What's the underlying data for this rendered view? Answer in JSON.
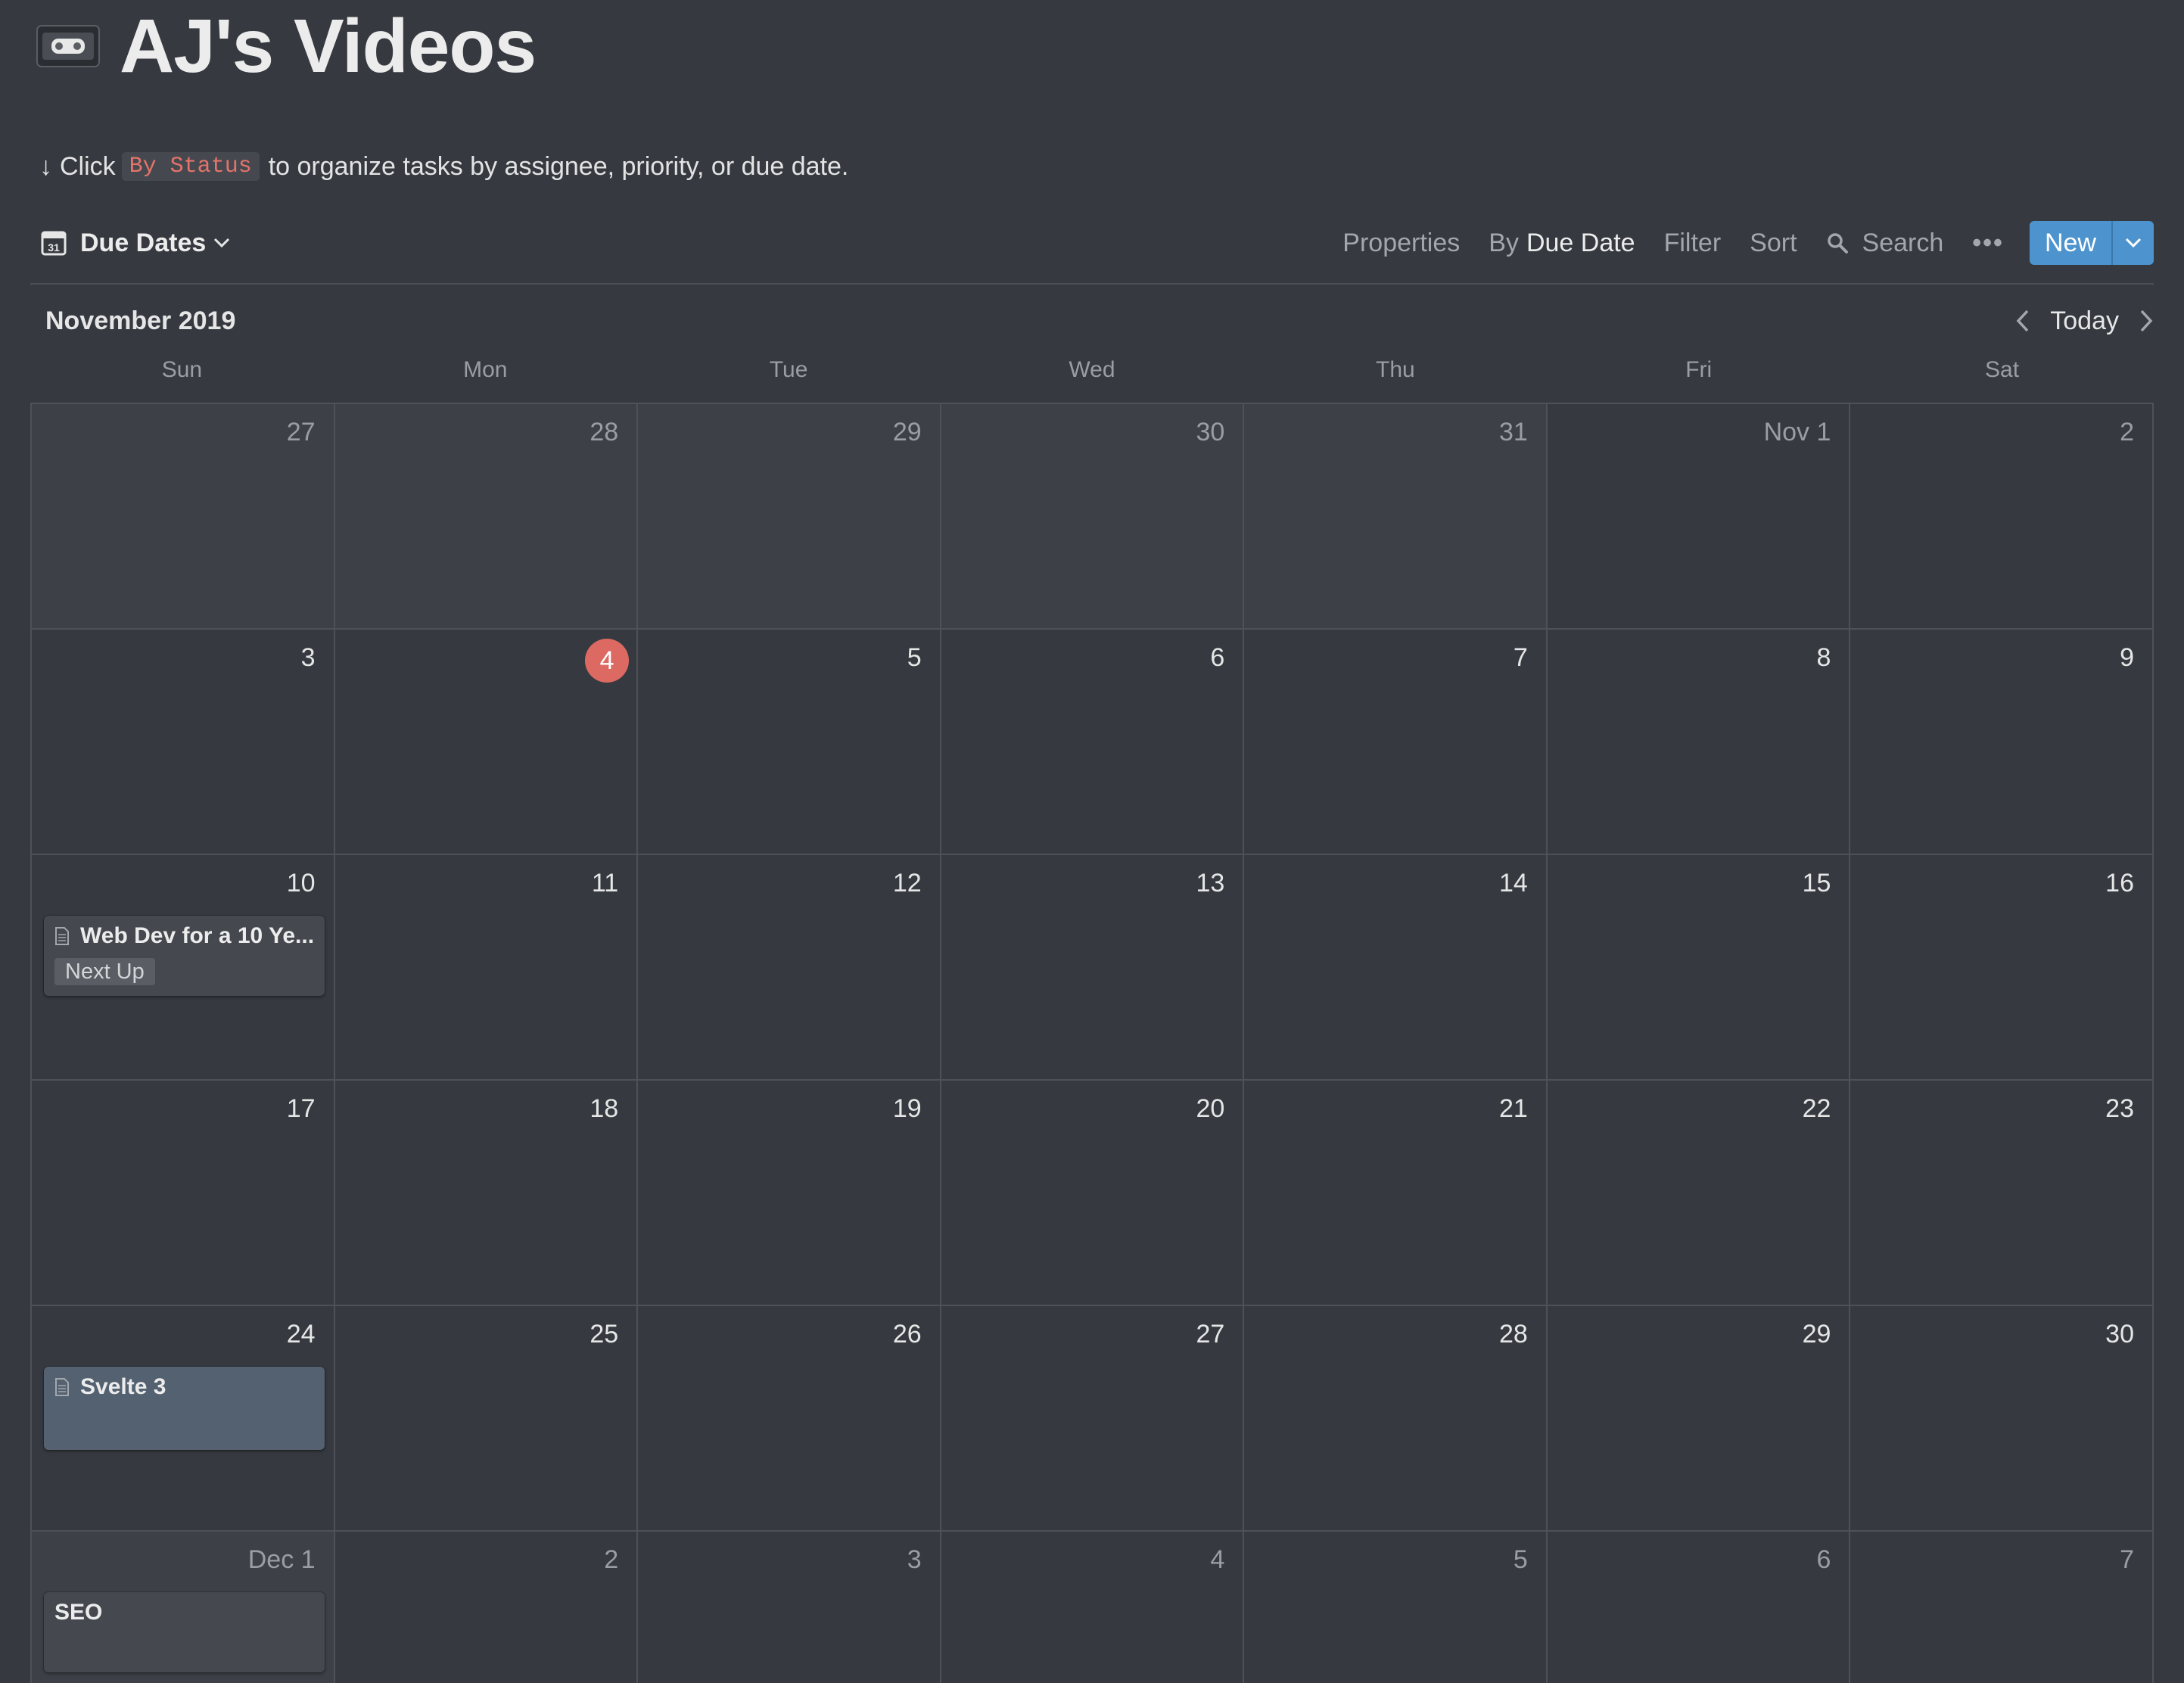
{
  "page": {
    "title": "AJ's Videos",
    "icon": "vhs-tape-icon"
  },
  "hint": {
    "arrow": "↓",
    "prefix": "Click",
    "code": "By Status",
    "suffix": "to organize tasks by assignee, priority, or due date."
  },
  "toolbar": {
    "view_name": "Due Dates",
    "properties": "Properties",
    "group_by_prefix": "By",
    "group_by_value": "Due Date",
    "filter": "Filter",
    "sort": "Sort",
    "search": "Search",
    "more": "•••",
    "new": "New"
  },
  "calendar": {
    "month_label": "November 2019",
    "today_label": "Today",
    "weekdays": [
      "Sun",
      "Mon",
      "Tue",
      "Wed",
      "Thu",
      "Fri",
      "Sat"
    ],
    "weeks": [
      [
        "27",
        "28",
        "29",
        "30",
        "31",
        "Nov 1",
        "2"
      ],
      [
        "3",
        "4",
        "5",
        "6",
        "7",
        "8",
        "9"
      ],
      [
        "10",
        "11",
        "12",
        "13",
        "14",
        "15",
        "16"
      ],
      [
        "17",
        "18",
        "19",
        "20",
        "21",
        "22",
        "23"
      ],
      [
        "24",
        "25",
        "26",
        "27",
        "28",
        "29",
        "30"
      ],
      [
        "Dec 1",
        "2",
        "3",
        "4",
        "5",
        "6",
        "7"
      ]
    ],
    "today_day": "4",
    "events": [
      {
        "title": "Web Dev for a 10 Ye...",
        "tag": "Next Up"
      },
      {
        "title": "Svelte 3"
      },
      {
        "title": "SEO"
      }
    ]
  },
  "colors": {
    "background": "#363a40",
    "accent": "#4d94ce",
    "today": "#dc6a63",
    "code": "#e5736a"
  }
}
